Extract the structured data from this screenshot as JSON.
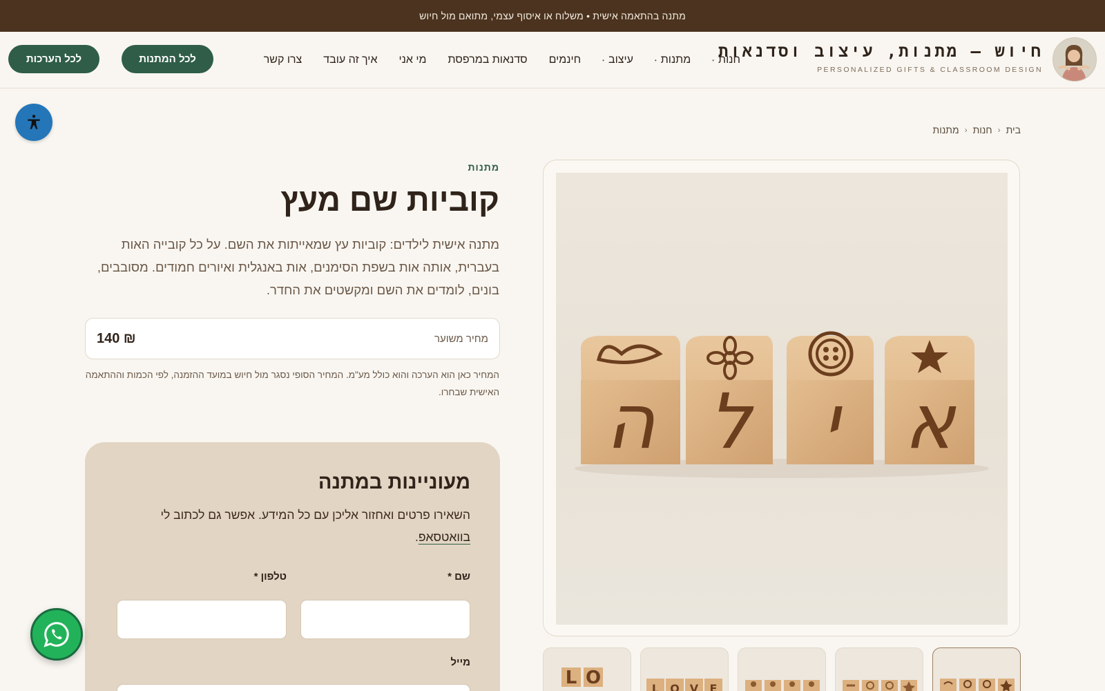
{
  "announcement": "מתנה בהתאמה אישית • משלוח או איסוף עצמי, מתואם מול חיוש",
  "header": {
    "brand_title": "חיוש – מתנות, עיצוב וסדנאות",
    "brand_subtitle": "PERSONALIZED GIFTS & CLASSROOM DESIGN",
    "nav": [
      {
        "label": "חנות",
        "has_dropdown": true
      },
      {
        "label": "מתנות",
        "has_dropdown": true
      },
      {
        "label": "עיצוב",
        "has_dropdown": true
      },
      {
        "label": "חינמים",
        "has_dropdown": false
      },
      {
        "label": "סדנאות במרפסת",
        "has_dropdown": false
      },
      {
        "label": "מי אני",
        "has_dropdown": false
      },
      {
        "label": "איך זה עובד",
        "has_dropdown": false
      },
      {
        "label": "צרו קשר",
        "has_dropdown": false
      }
    ],
    "btn_gifts": "לכל המתנות",
    "btn_kits": "לכל הערכות"
  },
  "breadcrumb": [
    "בית",
    "חנות",
    "מתנות"
  ],
  "product": {
    "category": "מתנות",
    "title": "קוביות שם מעץ",
    "description": "מתנה אישית לילדים: קוביות עץ שמאייתות את השם. על כל קובייה האות בעברית, אותה אות בשפת הסימנים, אות באנגלית ואיורים חמודים. מסובבים, בונים, לומדים את השם ומקשטים את החדר.",
    "price_label": "מחיר משוער",
    "price_value": "140 ₪",
    "price_note": "המחיר כאן הוא הערכה והוא כולל מע\"מ. המחיר הסופי נסגר מול חיוש במועד ההזמנה, לפי הכמות וההתאמה האישית שבחרו."
  },
  "gallery": {
    "cubes": [
      {
        "letter": "א",
        "icon": "star"
      },
      {
        "letter": "י",
        "icon": "button"
      },
      {
        "letter": "ל",
        "icon": "flower"
      },
      {
        "letter": "ה",
        "icon": "heart"
      }
    ],
    "thumb_count": 5,
    "thumb_words": [
      "",
      "",
      "",
      "LOVE",
      "LO"
    ]
  },
  "form": {
    "title": "מעוניינות במתנה",
    "desc_before": "השאירו פרטים ואחזור אליכן עם כל המידע. אפשר גם לכתוב לי ",
    "desc_link": "בוואטסאפ",
    "desc_after": ".",
    "name_label": "שם *",
    "phone_label": "טלפון *",
    "email_label": "מייל"
  },
  "colors": {
    "announcement_bg": "#4b331f",
    "accent_green": "#2f5d48",
    "form_bg": "#e2d5c4",
    "page_bg": "#f9f6f1",
    "whatsapp": "#22b35a",
    "a11y": "#2476b8"
  }
}
